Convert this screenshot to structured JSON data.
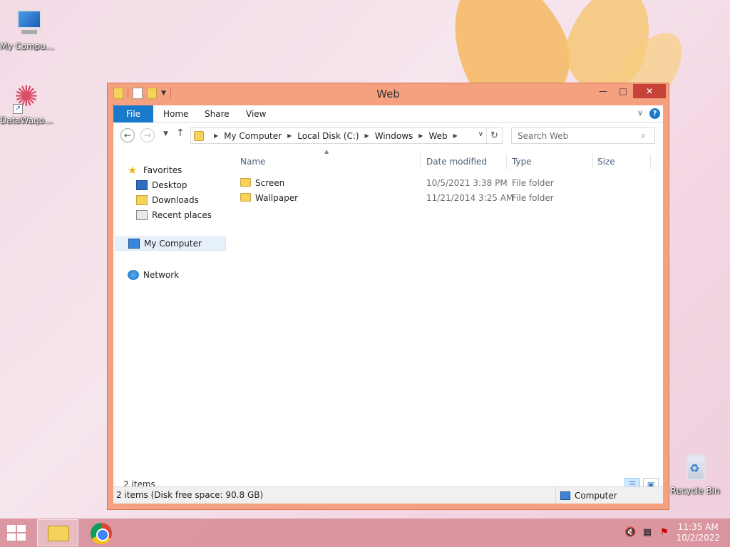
{
  "desktop": {
    "icons": [
      {
        "label": "My Computer",
        "icon": "computer-icon"
      },
      {
        "label": "DataWagon...",
        "icon": "datawagon-icon"
      },
      {
        "label": "Recycle Bin",
        "icon": "recycle-bin-icon"
      }
    ]
  },
  "window": {
    "title": "Web",
    "controls": {
      "minimize": "—",
      "maximize": "□",
      "close": "✕"
    }
  },
  "ribbon": {
    "tabs": [
      "File",
      "Home",
      "Share",
      "View"
    ],
    "active": "File",
    "accent": "#1979ca"
  },
  "navbar": {
    "breadcrumbs": [
      "My Computer",
      "Local Disk (C:)",
      "Windows",
      "Web"
    ],
    "search": {
      "placeholder": "Search Web",
      "value": ""
    }
  },
  "navpane": {
    "favorites_label": "Favorites",
    "favorites": [
      "Desktop",
      "Downloads",
      "Recent places"
    ],
    "computer": "My Computer",
    "network": "Network"
  },
  "filelist": {
    "columns": [
      "Name",
      "Date modified",
      "Type",
      "Size"
    ],
    "rows": [
      {
        "name": "Screen",
        "date": "10/5/2021 3:38 PM",
        "type": "File folder",
        "size": ""
      },
      {
        "name": "Wallpaper",
        "date": "11/21/2014 3:25 AM",
        "type": "File folder",
        "size": ""
      }
    ],
    "item_count": "2 items"
  },
  "statusbar": {
    "left": "2 items (Disk free space: 90.8 GB)",
    "right": "Computer"
  },
  "taskbar": {
    "apps": [
      "file-explorer-icon",
      "chrome-icon"
    ],
    "tray_icons": [
      "volume-muted-icon",
      "network-icon",
      "action-center-icon"
    ],
    "time": "11:35 AM",
    "date": "10/2/2022"
  },
  "colors": {
    "window_frame": "#f5a07e",
    "close_button": "#c7433a",
    "taskbar": "#d68c96"
  }
}
